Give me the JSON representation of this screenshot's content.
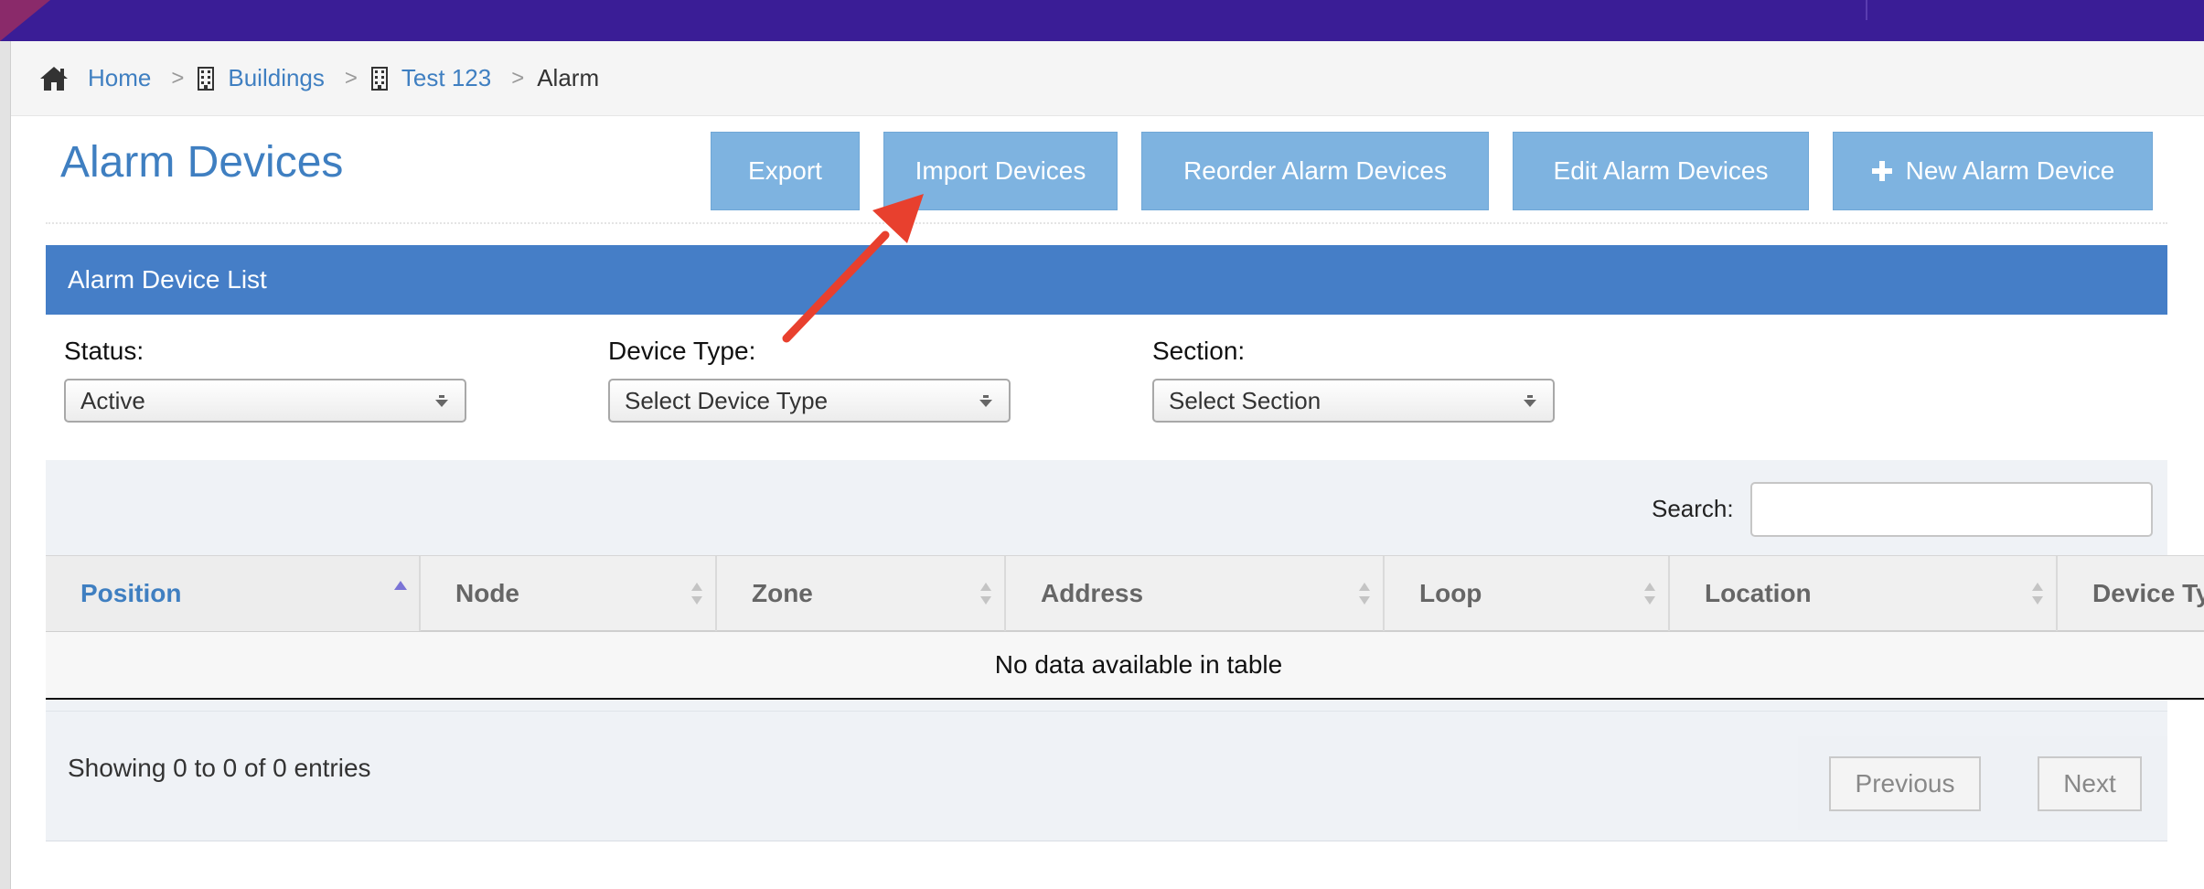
{
  "breadcrumb": {
    "home": "Home",
    "buildings": "Buildings",
    "building": "Test 123",
    "current": "Alarm",
    "separator": ">"
  },
  "page": {
    "title": "Alarm Devices"
  },
  "toolbar": {
    "export": "Export",
    "import": "Import Devices",
    "reorder": "Reorder Alarm Devices",
    "edit": "Edit Alarm Devices",
    "new": "New Alarm Device"
  },
  "panel": {
    "title": "Alarm Device List"
  },
  "filters": {
    "status": {
      "label": "Status:",
      "value": "Active"
    },
    "device_type": {
      "label": "Device Type:",
      "value": "Select Device Type"
    },
    "section": {
      "label": "Section:",
      "value": "Select Section"
    }
  },
  "search": {
    "label": "Search:",
    "value": ""
  },
  "table": {
    "columns": [
      "Position",
      "Node",
      "Zone",
      "Address",
      "Loop",
      "Location",
      "Device Ty"
    ],
    "sorted_column": "Position",
    "sort_direction": "ascending",
    "empty_message": "No data available in table"
  },
  "footer": {
    "info": "Showing 0 to 0 of 0 entries",
    "previous": "Previous",
    "next": "Next"
  },
  "colors": {
    "topbar": "#3a1d96",
    "link": "#3f7fc1",
    "button": "#7eb3e0",
    "panel_header": "#457ec7",
    "annotation_arrow": "#e8402e"
  },
  "icons": {
    "home": "home-icon",
    "building": "building-icon",
    "plus": "plus-icon",
    "sort": "sort-icon",
    "dropdown": "dropdown-arrow-icon",
    "annotation": "annotation-arrow-icon"
  }
}
